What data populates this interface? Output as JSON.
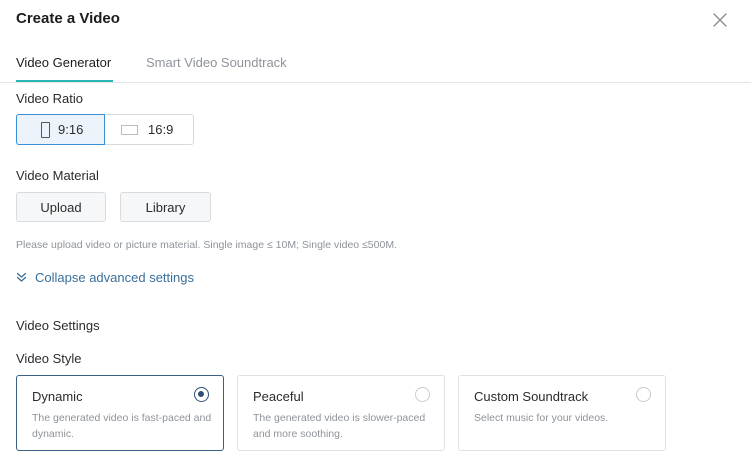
{
  "dialog": {
    "title": "Create a Video"
  },
  "tabs": [
    {
      "label": "Video Generator",
      "active": true
    },
    {
      "label": "Smart Video Soundtrack",
      "active": false
    }
  ],
  "video_ratio": {
    "label": "Video Ratio",
    "options": [
      {
        "label": "9:16",
        "icon": "portrait-rect-icon",
        "selected": true
      },
      {
        "label": "16:9",
        "icon": "landscape-rect-icon",
        "selected": false
      }
    ]
  },
  "video_material": {
    "label": "Video Material",
    "upload_label": "Upload",
    "library_label": "Library",
    "hint": "Please upload video or picture material. Single image ≤ 10M; Single video ≤500M."
  },
  "advanced": {
    "collapse_label": "Collapse advanced settings",
    "icon": "double-chevron-down-icon"
  },
  "video_settings": {
    "heading": "Video Settings",
    "style_label": "Video Style",
    "styles": [
      {
        "title": "Dynamic",
        "description": "The generated video is fast-paced and dynamic.",
        "selected": true
      },
      {
        "title": "Peaceful",
        "description": "The generated video is slower-paced and more soothing.",
        "selected": false
      },
      {
        "title": "Custom Soundtrack",
        "description": "Select music for your videos.",
        "selected": false
      }
    ]
  },
  "colors": {
    "accent_tab": "#29b6b3",
    "selected_border": "#3a8fd8",
    "link": "#3a6f9c",
    "radio_checked": "#2f4f74"
  }
}
